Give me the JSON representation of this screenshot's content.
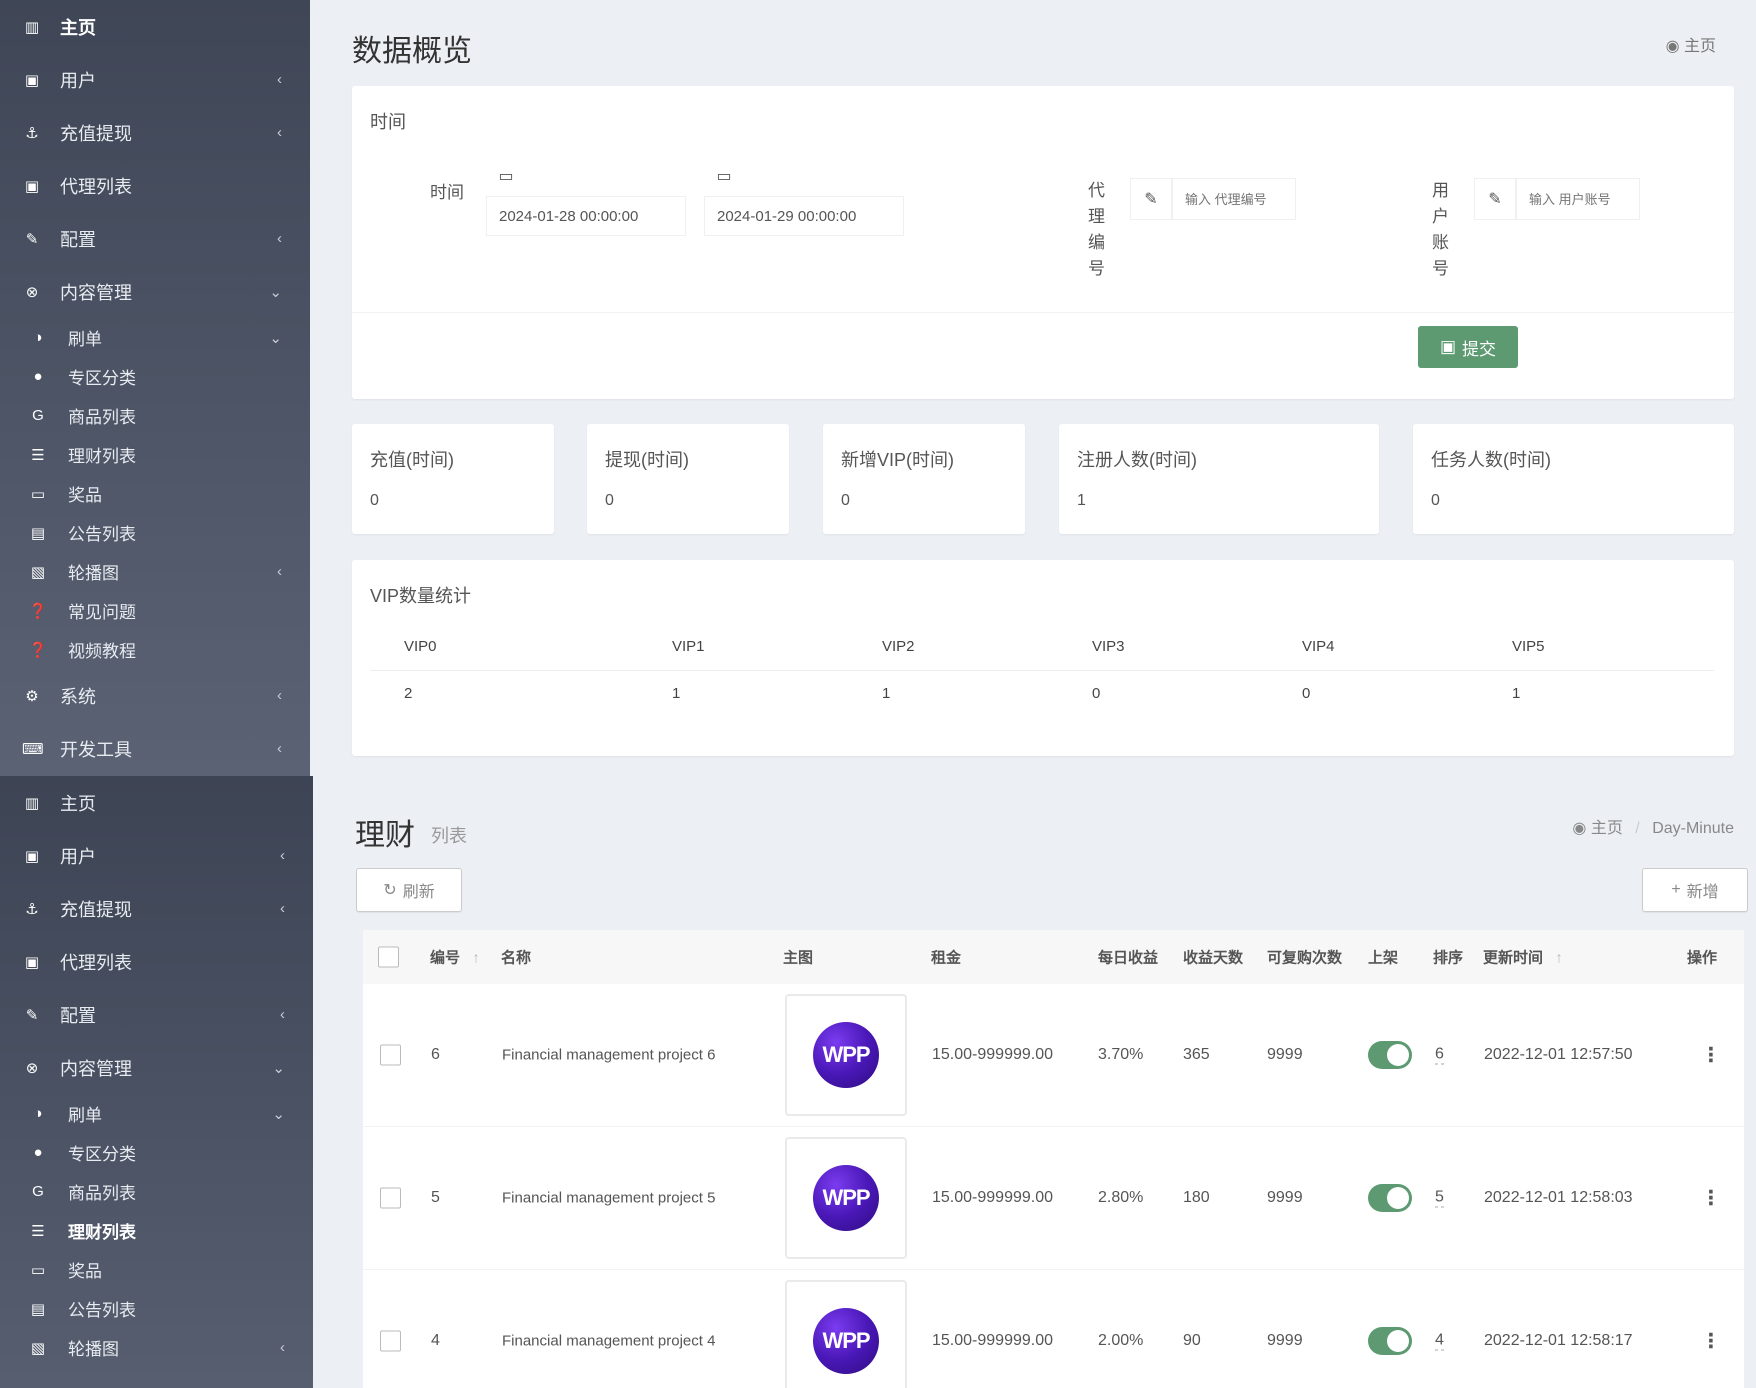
{
  "sidebar_top": {
    "items": [
      {
        "icon": "▥",
        "label": "主页",
        "arrow": "",
        "sub": false,
        "active": true
      },
      {
        "icon": "▣",
        "label": "用户",
        "arrow": "‹",
        "sub": false,
        "active": false
      },
      {
        "icon": "⚓",
        "label": "充值提现",
        "arrow": "‹",
        "sub": false,
        "active": false
      },
      {
        "icon": "▣",
        "label": "代理列表",
        "arrow": "",
        "sub": false,
        "active": false
      },
      {
        "icon": "✎",
        "label": "配置",
        "arrow": "‹",
        "sub": false,
        "active": false
      },
      {
        "icon": "⊗",
        "label": "内容管理",
        "arrow": "⌄",
        "sub": false,
        "active": false
      },
      {
        "icon": "◑",
        "label": "刷单",
        "arrow": "⌄",
        "sub": true,
        "active": false
      },
      {
        "icon": "●",
        "label": "专区分类",
        "arrow": "",
        "sub": true,
        "active": false
      },
      {
        "icon": "G",
        "label": "商品列表",
        "arrow": "",
        "sub": true,
        "active": false
      },
      {
        "icon": "☰",
        "label": "理财列表",
        "arrow": "",
        "sub": true,
        "active": false
      },
      {
        "icon": "▭",
        "label": "奖品",
        "arrow": "",
        "sub": true,
        "active": false
      },
      {
        "icon": "▤",
        "label": "公告列表",
        "arrow": "",
        "sub": true,
        "active": false
      },
      {
        "icon": "▧",
        "label": "轮播图",
        "arrow": "‹",
        "sub": true,
        "active": false
      },
      {
        "icon": "❓",
        "label": "常见问题",
        "arrow": "",
        "sub": true,
        "active": false
      },
      {
        "icon": "❓",
        "label": "视频教程",
        "arrow": "",
        "sub": true,
        "active": false
      },
      {
        "icon": "⚙",
        "label": "系统",
        "arrow": "‹",
        "sub": false,
        "active": false
      },
      {
        "icon": "⌨",
        "label": "开发工具",
        "arrow": "‹",
        "sub": false,
        "active": false
      }
    ]
  },
  "sidebar_bottom": {
    "items": [
      {
        "icon": "▥",
        "label": "主页",
        "arrow": "",
        "sub": false,
        "active": false
      },
      {
        "icon": "▣",
        "label": "用户",
        "arrow": "‹",
        "sub": false,
        "active": false
      },
      {
        "icon": "⚓",
        "label": "充值提现",
        "arrow": "‹",
        "sub": false,
        "active": false
      },
      {
        "icon": "▣",
        "label": "代理列表",
        "arrow": "",
        "sub": false,
        "active": false
      },
      {
        "icon": "✎",
        "label": "配置",
        "arrow": "‹",
        "sub": false,
        "active": false
      },
      {
        "icon": "⊗",
        "label": "内容管理",
        "arrow": "⌄",
        "sub": false,
        "active": false
      },
      {
        "icon": "◑",
        "label": "刷单",
        "arrow": "⌄",
        "sub": true,
        "active": false
      },
      {
        "icon": "●",
        "label": "专区分类",
        "arrow": "",
        "sub": true,
        "active": false
      },
      {
        "icon": "G",
        "label": "商品列表",
        "arrow": "",
        "sub": true,
        "active": false
      },
      {
        "icon": "☰",
        "label": "理财列表",
        "arrow": "",
        "sub": true,
        "active": true
      },
      {
        "icon": "▭",
        "label": "奖品",
        "arrow": "",
        "sub": true,
        "active": false
      },
      {
        "icon": "▤",
        "label": "公告列表",
        "arrow": "",
        "sub": true,
        "active": false
      },
      {
        "icon": "▧",
        "label": "轮播图",
        "arrow": "‹",
        "sub": true,
        "active": false
      }
    ]
  },
  "overview": {
    "title": "数据概览",
    "crumb": "主页",
    "filter": {
      "box_title": "时间",
      "time_label": "时间",
      "start_date": "2024-01-28 00:00:00",
      "end_date": "2024-01-29 00:00:00",
      "agent_label": "代理编号",
      "agent_placeholder": "输入 代理编号",
      "user_label": "用户账号",
      "user_placeholder": "输入 用户账号",
      "submit_label": "提交"
    },
    "stats": [
      {
        "title": "充值(时间)",
        "value": "0"
      },
      {
        "title": "提现(时间)",
        "value": "0"
      },
      {
        "title": "新增VIP(时间)",
        "value": "0"
      },
      {
        "title": "注册人数(时间)",
        "value": "1"
      },
      {
        "title": "任务人数(时间)",
        "value": "0"
      }
    ],
    "vip": {
      "title": "VIP数量统计",
      "headers": [
        "VIP0",
        "VIP1",
        "VIP2",
        "VIP3",
        "VIP4",
        "VIP5"
      ],
      "values": [
        "2",
        "1",
        "1",
        "0",
        "0",
        "1"
      ]
    }
  },
  "licai": {
    "title": "理财",
    "subtitle": "列表",
    "crumb_home": "主页",
    "crumb_sep": "/",
    "crumb_current": "Day-Minute",
    "refresh_label": "刷新",
    "add_label": "新增",
    "columns": {
      "id": "编号",
      "name": "名称",
      "image": "主图",
      "rent": "租金",
      "daily": "每日收益",
      "days": "收益天数",
      "times": "可复购次数",
      "shelf": "上架",
      "sort": "排序",
      "updated": "更新时间",
      "ops": "操作"
    },
    "rows": [
      {
        "id": "6",
        "name": "Financial management project 6",
        "logo": "WPP",
        "rent": "15.00-999999.00",
        "daily": "3.70%",
        "days": "365",
        "times": "9999",
        "sort": "6",
        "updated": "2022-12-01 12:57:50"
      },
      {
        "id": "5",
        "name": "Financial management project 5",
        "logo": "WPP",
        "rent": "15.00-999999.00",
        "daily": "2.80%",
        "days": "180",
        "times": "9999",
        "sort": "5",
        "updated": "2022-12-01 12:58:03"
      },
      {
        "id": "4",
        "name": "Financial management project 4",
        "logo": "WPP",
        "rent": "15.00-999999.00",
        "daily": "2.00%",
        "days": "90",
        "times": "9999",
        "sort": "4",
        "updated": "2022-12-01 12:58:17"
      }
    ]
  },
  "icons": {
    "calendar": "▭",
    "pencil": "✎",
    "save": "▣",
    "refresh": "↻",
    "plus": "+",
    "sort_up": "↑",
    "kebab": "⋮",
    "dashboard": "◉"
  }
}
